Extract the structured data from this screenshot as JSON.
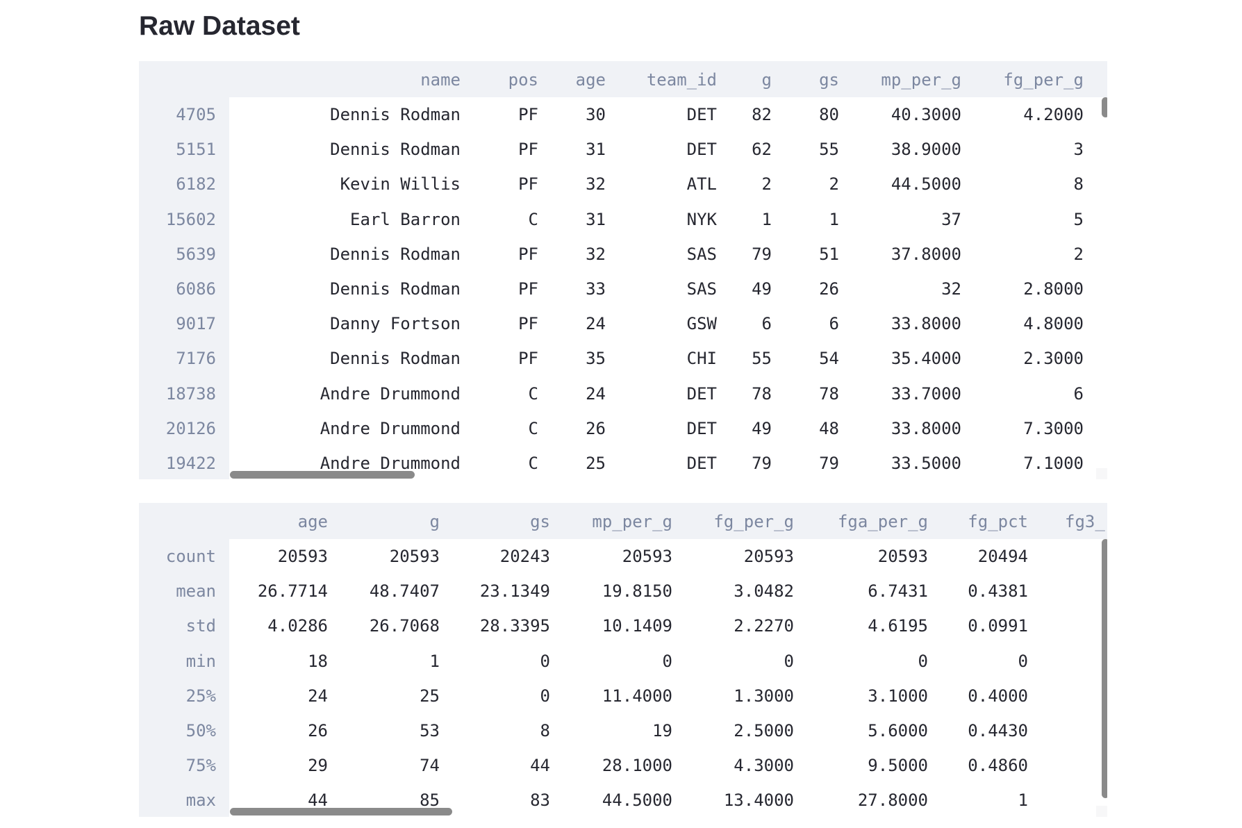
{
  "title": "Raw Dataset",
  "raw_table": {
    "columns": [
      "name",
      "pos",
      "age",
      "team_id",
      "g",
      "gs",
      "mp_per_g",
      "fg_per_g"
    ],
    "rows": [
      {
        "index": "4705",
        "cells": [
          "Dennis Rodman",
          "PF",
          "30",
          "DET",
          "82",
          "80",
          "40.3000",
          "4.2000"
        ]
      },
      {
        "index": "5151",
        "cells": [
          "Dennis Rodman",
          "PF",
          "31",
          "DET",
          "62",
          "55",
          "38.9000",
          "3"
        ]
      },
      {
        "index": "6182",
        "cells": [
          "Kevin Willis",
          "PF",
          "32",
          "ATL",
          "2",
          "2",
          "44.5000",
          "8"
        ]
      },
      {
        "index": "15602",
        "cells": [
          "Earl Barron",
          "C",
          "31",
          "NYK",
          "1",
          "1",
          "37",
          "5"
        ]
      },
      {
        "index": "5639",
        "cells": [
          "Dennis Rodman",
          "PF",
          "32",
          "SAS",
          "79",
          "51",
          "37.8000",
          "2"
        ]
      },
      {
        "index": "6086",
        "cells": [
          "Dennis Rodman",
          "PF",
          "33",
          "SAS",
          "49",
          "26",
          "32",
          "2.8000"
        ]
      },
      {
        "index": "9017",
        "cells": [
          "Danny Fortson",
          "PF",
          "24",
          "GSW",
          "6",
          "6",
          "33.8000",
          "4.8000"
        ]
      },
      {
        "index": "7176",
        "cells": [
          "Dennis Rodman",
          "PF",
          "35",
          "CHI",
          "55",
          "54",
          "35.4000",
          "2.3000"
        ]
      },
      {
        "index": "18738",
        "cells": [
          "Andre Drummond",
          "C",
          "24",
          "DET",
          "78",
          "78",
          "33.7000",
          "6"
        ]
      },
      {
        "index": "20126",
        "cells": [
          "Andre Drummond",
          "C",
          "26",
          "DET",
          "49",
          "48",
          "33.8000",
          "7.3000"
        ]
      },
      {
        "index": "19422",
        "cells": [
          "Andre Drummond",
          "C",
          "25",
          "DET",
          "79",
          "79",
          "33.5000",
          "7.1000"
        ]
      }
    ]
  },
  "stats_table": {
    "columns": [
      "age",
      "g",
      "gs",
      "mp_per_g",
      "fg_per_g",
      "fga_per_g",
      "fg_pct",
      "fg3_"
    ],
    "rows": [
      {
        "index": "count",
        "cells": [
          "20593",
          "20593",
          "20243",
          "20593",
          "20593",
          "20593",
          "20494"
        ]
      },
      {
        "index": "mean",
        "cells": [
          "26.7714",
          "48.7407",
          "23.1349",
          "19.8150",
          "3.0482",
          "6.7431",
          "0.4381"
        ]
      },
      {
        "index": "std",
        "cells": [
          "4.0286",
          "26.7068",
          "28.3395",
          "10.1409",
          "2.2270",
          "4.6195",
          "0.0991"
        ]
      },
      {
        "index": "min",
        "cells": [
          "18",
          "1",
          "0",
          "0",
          "0",
          "0",
          "0"
        ]
      },
      {
        "index": "25%",
        "cells": [
          "24",
          "25",
          "0",
          "11.4000",
          "1.3000",
          "3.1000",
          "0.4000"
        ]
      },
      {
        "index": "50%",
        "cells": [
          "26",
          "53",
          "8",
          "19",
          "2.5000",
          "5.6000",
          "0.4430"
        ]
      },
      {
        "index": "75%",
        "cells": [
          "29",
          "74",
          "44",
          "28.1000",
          "4.3000",
          "9.5000",
          "0.4860"
        ]
      },
      {
        "index": "max",
        "cells": [
          "44",
          "85",
          "83",
          "44.5000",
          "13.4000",
          "27.8000",
          "1"
        ]
      }
    ]
  }
}
